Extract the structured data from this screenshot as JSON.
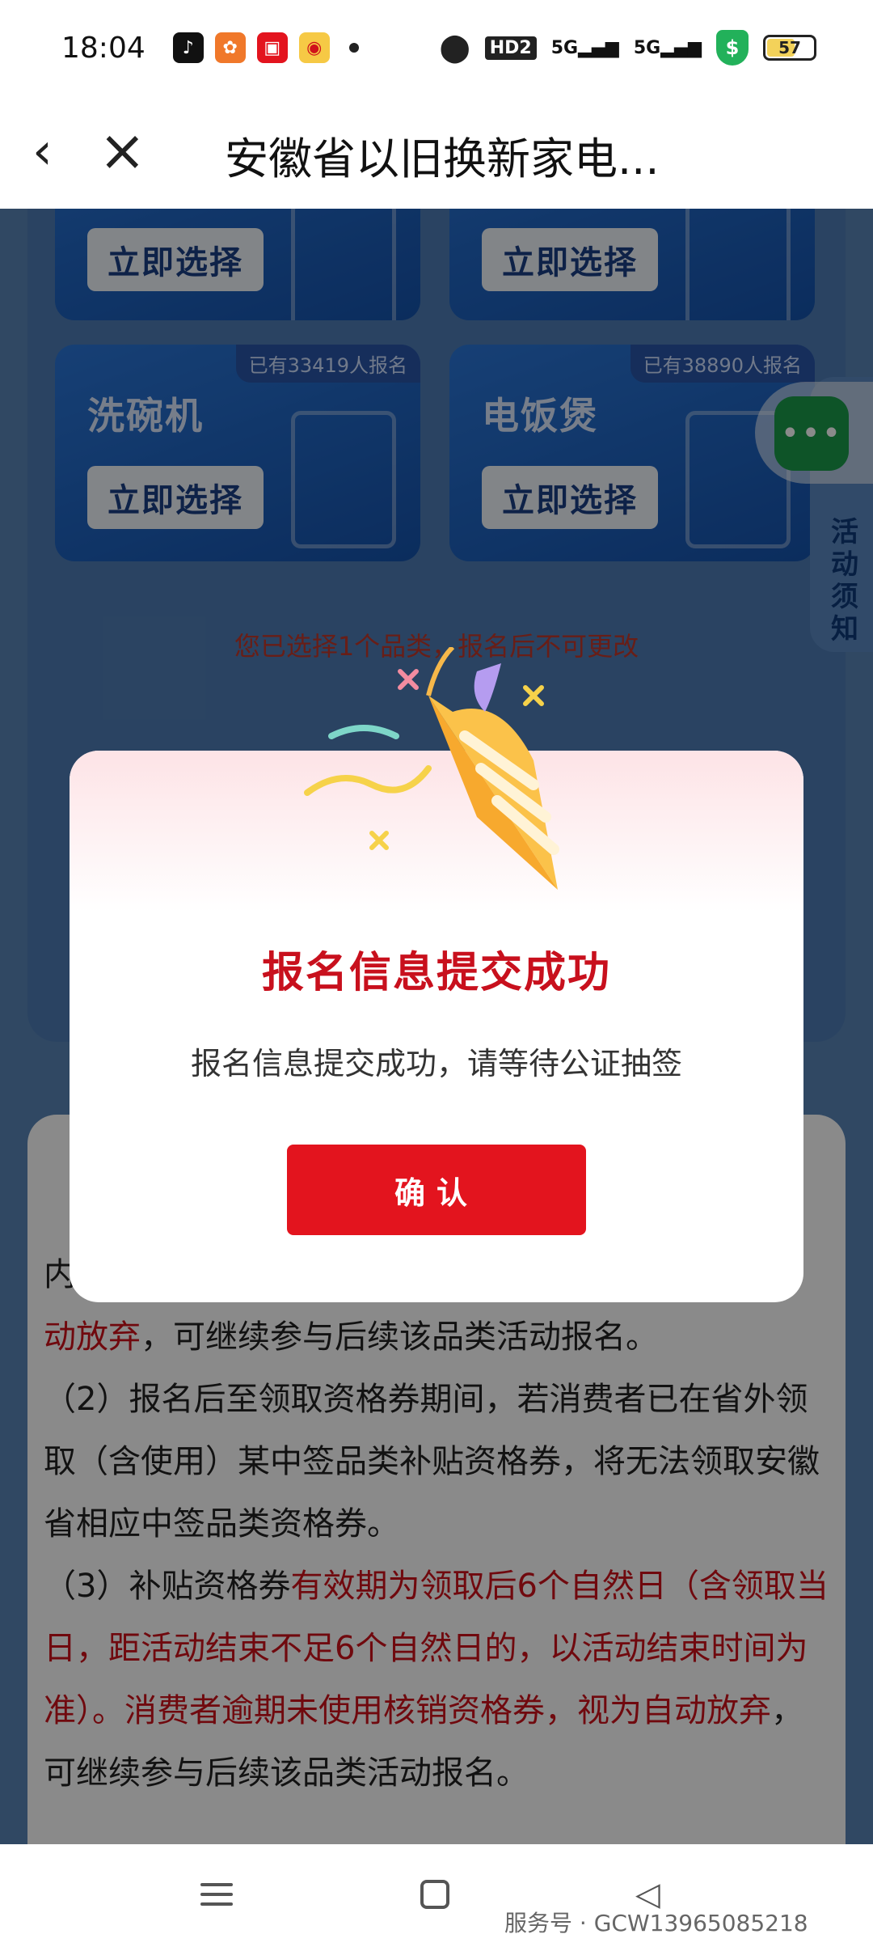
{
  "status_bar": {
    "time": "18:04",
    "network_hd": "HD2",
    "network_1": "5G",
    "network_2": "5G",
    "battery": "57"
  },
  "header": {
    "title": "安徽省以旧换新家电..."
  },
  "categories": [
    {
      "name": "",
      "badge": "",
      "button": "立即选择"
    },
    {
      "name": "",
      "badge": "",
      "button": "立即选择"
    },
    {
      "name": "洗碗机",
      "badge": "已有33419人报名",
      "button": "立即选择"
    },
    {
      "name": "电饭煲",
      "badge": "已有38890人报名",
      "button": "立即选择"
    }
  ],
  "selection_note": "您已选择1个品类，报名后不可更改",
  "side_tab": {
    "label": "活动须知"
  },
  "floating_chat": {
    "label": "•••"
  },
  "rules": {
    "p1_tail": "内",
    "p1_red": "动放弃",
    "p1_rest": "，可继续参与后续该品类活动报名。",
    "p2": "（2）报名后至领取资格券期间，若消费者已在省外领取（含使用）某中签品类补贴资格券，将无法领取安徽省相应中签品类资格券。",
    "p3_a": "（3）补贴资格券",
    "p3_red": "有效期为领取后6个自然日（含领取当日，距活动结束不足6个自然日的，以活动结束时间为准）。消费者逾期未使用核销资格券，视为自动放弃",
    "p3_rest": "，可继续参与后续该品类活动报名。"
  },
  "modal": {
    "title": "报名信息提交成功",
    "message": "报名信息提交成功，请等待公证抽签",
    "confirm": "确认"
  },
  "watermark": "服务号 · GCW13965085218"
}
